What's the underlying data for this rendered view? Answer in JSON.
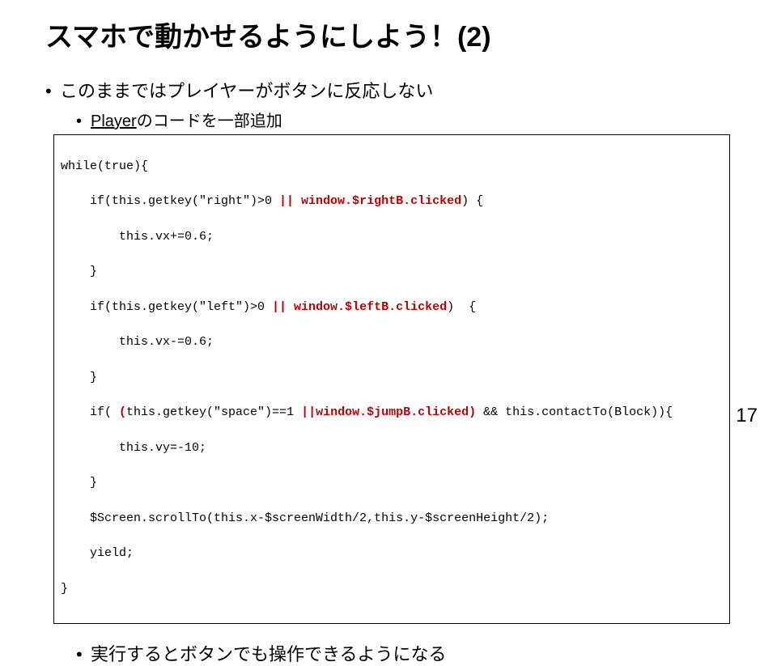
{
  "title": "スマホで動かせるようにしよう！(2)",
  "bullet1": "このままではプレイヤーがボタンに反応しない",
  "bullet2_pre": "Player",
  "bullet2_post": "のコードを一部追加",
  "code": {
    "l01": "while(true){",
    "l02a": "    if(this.getkey(\"right\")>0 ",
    "l02b": "|| window.$rightB.clicked",
    "l02c": ") {",
    "l03": "        this.vx+=0.6;",
    "l04": "    }",
    "l05a": "    if(this.getkey(\"left\")>0 ",
    "l05b": "|| window.$leftB.clicked",
    "l05c": ")  {",
    "l06": "        this.vx-=0.6;",
    "l07": "    }",
    "l08a": "    if( ",
    "l08b": "(",
    "l08c": "this.getkey(\"space\")==1 ",
    "l08d": "||window.$jumpB.clicked)",
    "l08e": " && this.contactTo(Block)){",
    "l09": "        this.vy=-10;",
    "l10": "    }",
    "l11": "    $Screen.scrollTo(this.x-$screenWidth/2,this.y-$screenHeight/2);",
    "l12": "    yield;",
    "l13": "}"
  },
  "bullet3": "実行するとボタンでも操作できるようになる",
  "page": "17"
}
